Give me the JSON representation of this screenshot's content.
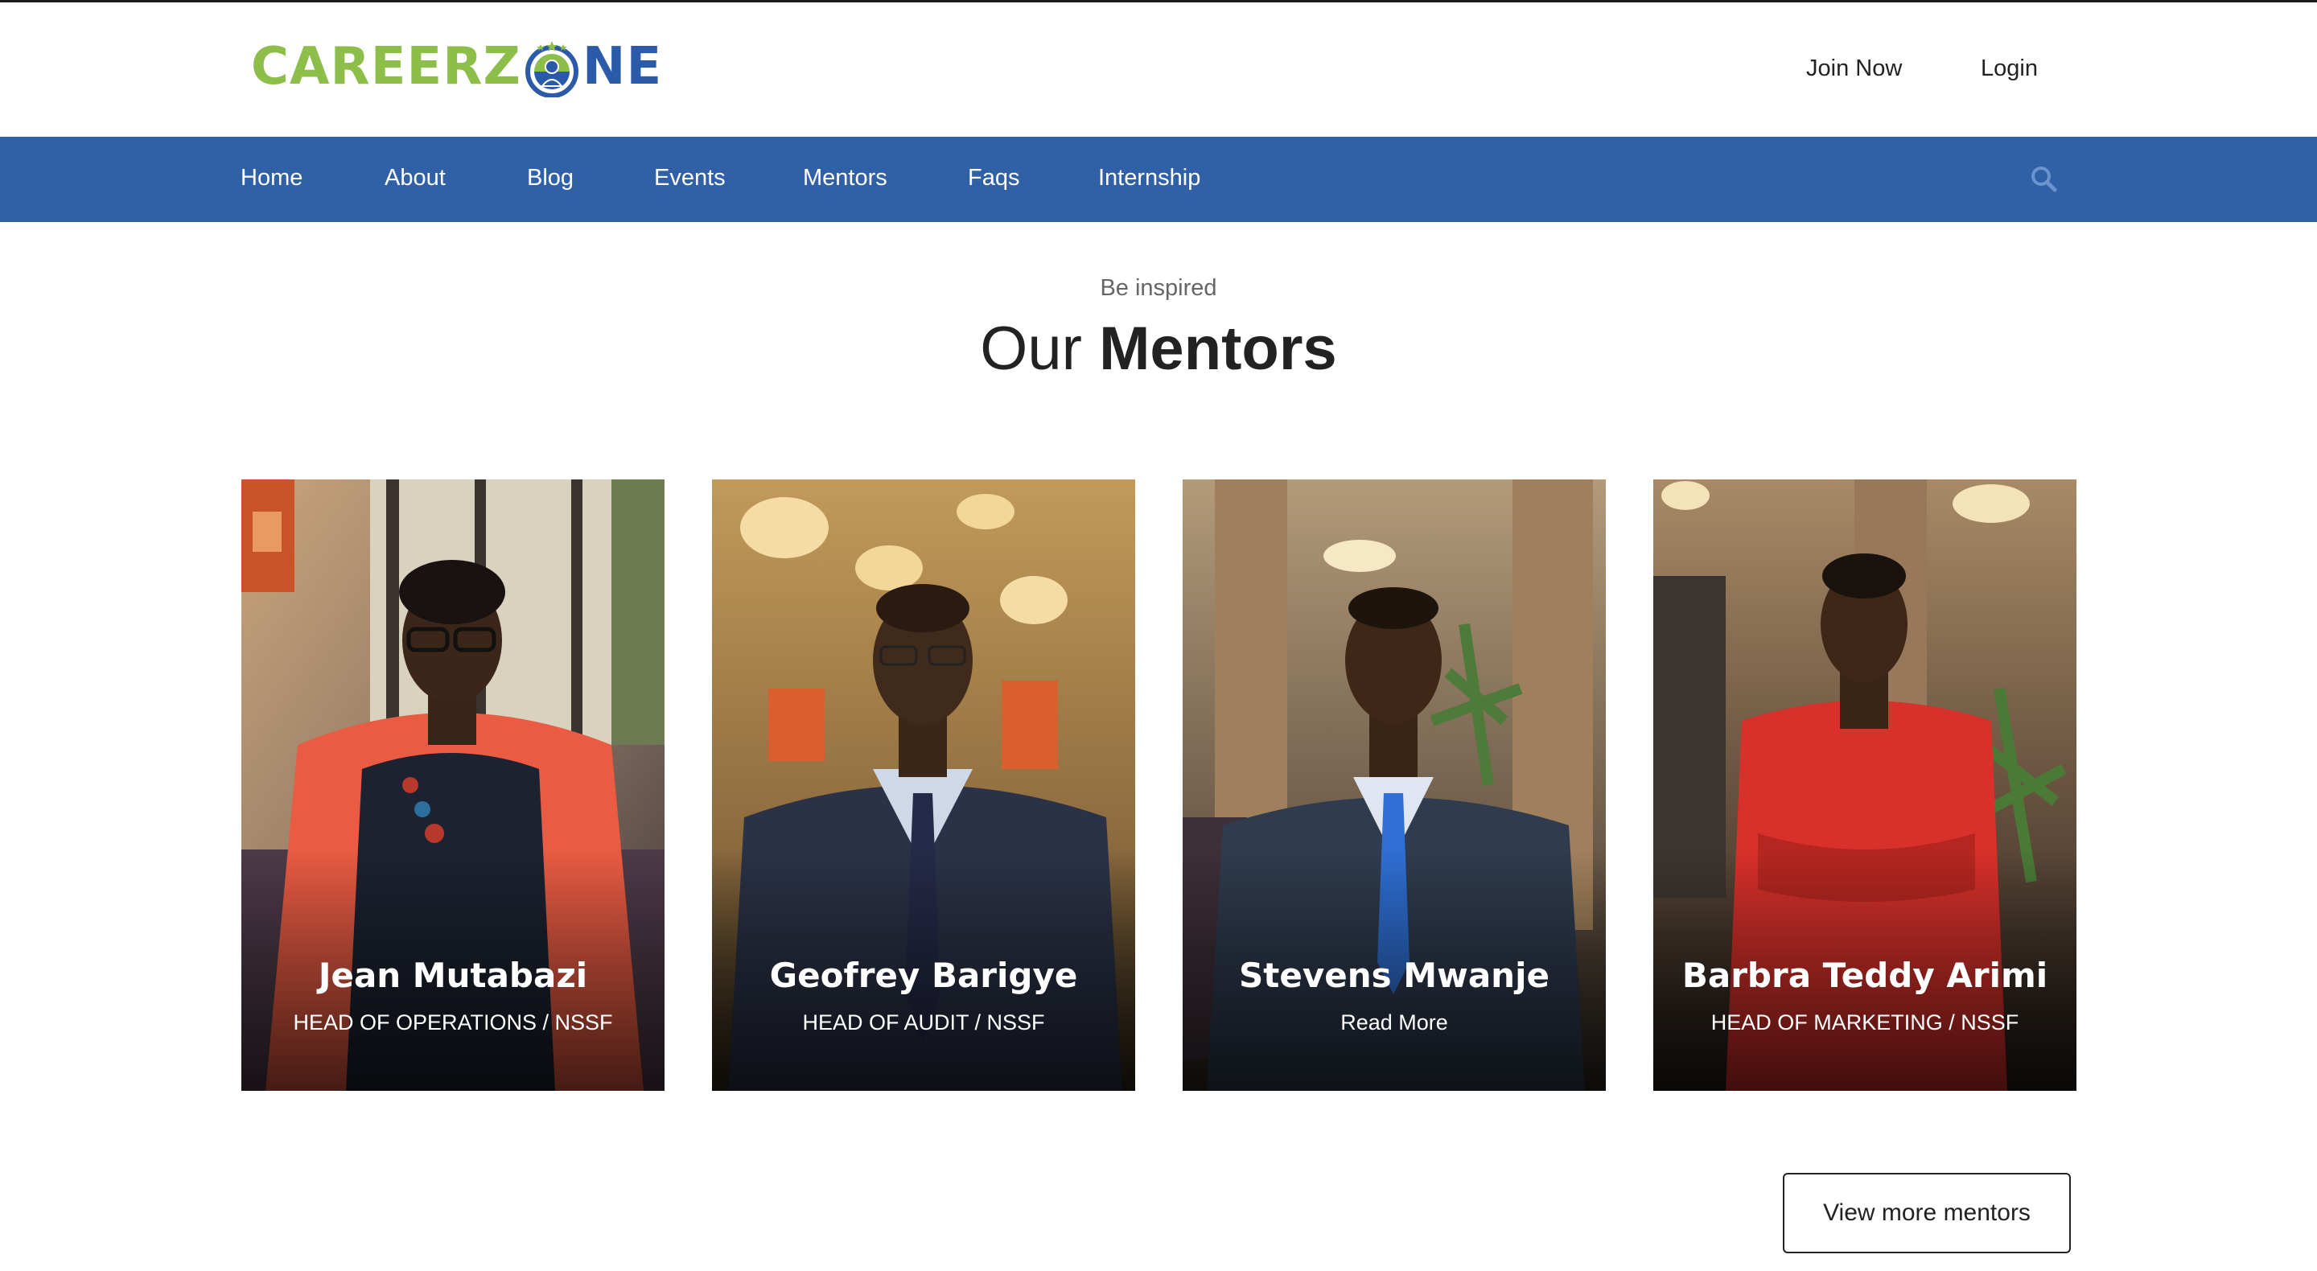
{
  "brand": {
    "logo_part1": "CAREERZ",
    "logo_part2": "NE",
    "color_green": "#8dbe4a",
    "color_blue": "#2b5aa8"
  },
  "header": {
    "join_label": "Join Now",
    "login_label": "Login"
  },
  "nav": {
    "items": [
      {
        "label": "Home"
      },
      {
        "label": "About"
      },
      {
        "label": "Blog"
      },
      {
        "label": "Events"
      },
      {
        "label": "Mentors"
      },
      {
        "label": "Faqs"
      },
      {
        "label": "Internship"
      }
    ],
    "search_icon": "search-icon",
    "bar_color": "#3060a6"
  },
  "section": {
    "eyebrow": "Be inspired",
    "title_light": "Our",
    "title_bold": "Mentors"
  },
  "mentors": [
    {
      "name": "Jean Mutabazi",
      "role": "HEAD OF OPERATIONS / NSSF"
    },
    {
      "name": "Geofrey Barigye",
      "role": "HEAD OF AUDIT / NSSF"
    },
    {
      "name": "Stevens Mwanje",
      "role": "Read More"
    },
    {
      "name": "Barbra Teddy Arimi",
      "role": "HEAD OF MARKETING / NSSF"
    }
  ],
  "footer": {
    "view_more_label": "View more mentors"
  }
}
